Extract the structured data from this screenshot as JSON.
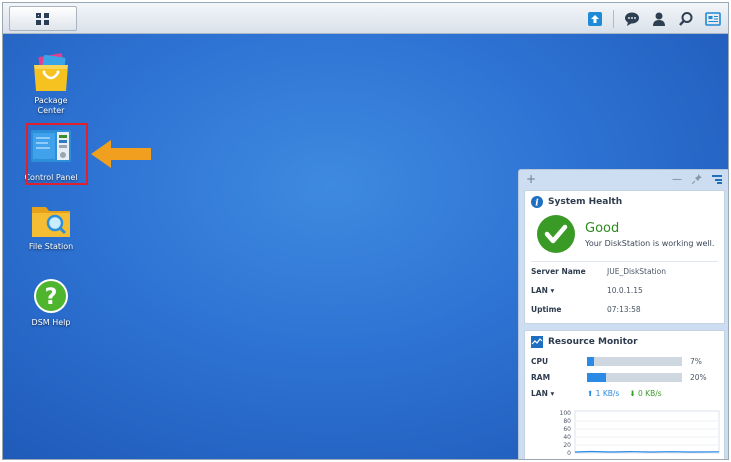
{
  "desktop": {
    "icons": [
      {
        "label_line1": "Package",
        "label_line2": "Center"
      },
      {
        "label_line1": "Control Panel"
      },
      {
        "label_line1": "File Station"
      },
      {
        "label_line1": "DSM Help"
      }
    ]
  },
  "taskbar": {
    "main_menu_icon": "main-menu-icon",
    "tray_icons": [
      "upload-icon",
      "chat-icon",
      "user-icon",
      "search-icon",
      "widgets-icon"
    ]
  },
  "widget": {
    "controls": {
      "add": "+",
      "minimize": "—"
    },
    "system_health": {
      "title": "System Health",
      "status": "Good",
      "message": "Your DiskStation is working well.",
      "rows": [
        {
          "key": "Server Name",
          "value": "JUE_DiskStation"
        },
        {
          "key": "LAN ▾",
          "value": "10.0.1.15"
        },
        {
          "key": "Uptime",
          "value": "07:13:58"
        }
      ]
    },
    "resource_monitor": {
      "title": "Resource Monitor",
      "cpu": {
        "label": "CPU",
        "percent": 7,
        "text": "7%"
      },
      "ram": {
        "label": "RAM",
        "percent": 20,
        "text": "20%"
      },
      "lan": {
        "label": "LAN ▾",
        "up": "1 KB/s",
        "down": "0 KB/s"
      },
      "graph_ticks": [
        "100",
        "80",
        "60",
        "40",
        "20",
        "0"
      ]
    }
  },
  "colors": {
    "accent": "#2a8ae6",
    "good": "#2d8a1e",
    "highlight": "#e0202a",
    "arrow": "#f0a01e"
  }
}
